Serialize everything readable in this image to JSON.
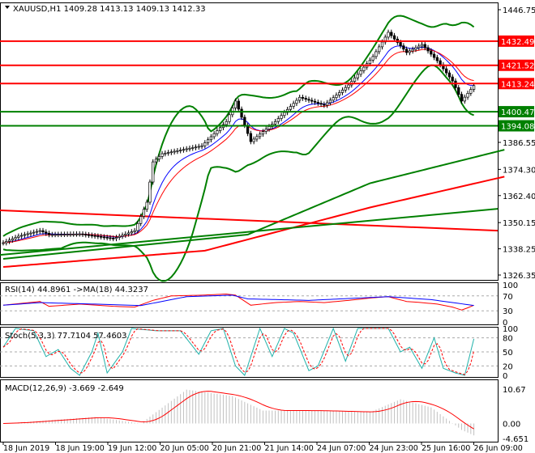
{
  "chart_data": {
    "type": "line",
    "title": "XAUUSD,H1",
    "ohlc": {
      "open": "1409.28",
      "high": "1413.13",
      "low": "1409.13",
      "close": "1412.33"
    },
    "price_axis": {
      "min": 1326.35,
      "max": 1446.75,
      "ticks": [
        "1446.75",
        "1386.55",
        "1374.30",
        "1362.40",
        "1350.15",
        "1338.25",
        "1326.35"
      ]
    },
    "levels": [
      {
        "value": 1432.49,
        "label": "1432.49",
        "color": "#ff0000"
      },
      {
        "value": 1421.52,
        "label": "1421.52",
        "color": "#ff0000"
      },
      {
        "value": 1413.24,
        "label": "1413.24",
        "color": "#ff0000"
      },
      {
        "value": 1400.47,
        "label": "1400.47",
        "color": "#008000"
      },
      {
        "value": 1394.08,
        "label": "1394.08",
        "color": "#008000"
      }
    ],
    "bars": 155,
    "close_anchors": [
      [
        0,
        1341
      ],
      [
        5,
        1344
      ],
      [
        12,
        1346.5
      ],
      [
        15,
        1344.7
      ],
      [
        25,
        1345
      ],
      [
        36,
        1342.9
      ],
      [
        43,
        1346.5
      ],
      [
        47,
        1359.4
      ],
      [
        49,
        1377.7
      ],
      [
        52,
        1381.4
      ],
      [
        65,
        1385
      ],
      [
        73,
        1396
      ],
      [
        76,
        1405.3
      ],
      [
        81,
        1386.9
      ],
      [
        89,
        1396
      ],
      [
        97,
        1407
      ],
      [
        105,
        1403.4
      ],
      [
        113,
        1412.6
      ],
      [
        121,
        1425.5
      ],
      [
        126,
        1436.5
      ],
      [
        132,
        1427.3
      ],
      [
        137,
        1431
      ],
      [
        142,
        1423.6
      ],
      [
        147,
        1414.4
      ],
      [
        150,
        1405.3
      ],
      [
        154,
        1412.33
      ]
    ],
    "ma_green_anchors": [
      [
        0,
        1333.7
      ],
      [
        80,
        1344.7
      ],
      [
        120,
        1368
      ],
      [
        164,
        1383.2
      ]
    ],
    "ma_red_anchors": [
      [
        0,
        1330
      ],
      [
        66,
        1337.4
      ],
      [
        120,
        1357
      ],
      [
        164,
        1371
      ]
    ],
    "trend_red": [
      [
        0,
        1355.7
      ],
      [
        170,
        1346.5
      ]
    ],
    "trend_green": [
      [
        0,
        1335.5
      ],
      [
        170,
        1356.4
      ]
    ],
    "time_labels": [
      "18 Jun 2019",
      "18 Jun 19:00",
      "19 Jun 12:00",
      "20 Jun 05:00",
      "20 Jun 21:00",
      "21 Jun 14:00",
      "24 Jun 07:00",
      "24 Jun 23:00",
      "25 Jun 16:00",
      "26 Jun 09:00"
    ],
    "rsi": {
      "label": "RSI(14) 44.8961  ->MA(18) 44.3237",
      "ticks": [
        "100",
        "70",
        "30",
        "0"
      ],
      "anchors": [
        [
          0,
          45
        ],
        [
          12,
          55
        ],
        [
          15,
          42
        ],
        [
          25,
          48
        ],
        [
          36,
          42
        ],
        [
          43,
          40
        ],
        [
          49,
          58
        ],
        [
          55,
          70
        ],
        [
          65,
          72
        ],
        [
          73,
          75
        ],
        [
          76,
          72
        ],
        [
          81,
          45
        ],
        [
          89,
          52
        ],
        [
          97,
          55
        ],
        [
          105,
          52
        ],
        [
          113,
          58
        ],
        [
          121,
          65
        ],
        [
          126,
          68
        ],
        [
          132,
          55
        ],
        [
          137,
          52
        ],
        [
          142,
          48
        ],
        [
          147,
          40
        ],
        [
          150,
          32
        ],
        [
          152,
          38
        ],
        [
          154,
          44.9
        ]
      ],
      "ma_anchors": [
        [
          0,
          45
        ],
        [
          12,
          52
        ],
        [
          30,
          48
        ],
        [
          45,
          44
        ],
        [
          60,
          68
        ],
        [
          75,
          72
        ],
        [
          80,
          62
        ],
        [
          100,
          58
        ],
        [
          126,
          68
        ],
        [
          140,
          60
        ],
        [
          154,
          44.3
        ]
      ]
    },
    "stoch": {
      "label": "Stoch(5,3,3) 77.7104 57.4603",
      "ticks": [
        "100",
        "80",
        "50",
        "20",
        "0"
      ],
      "anchors": [
        [
          0,
          60
        ],
        [
          4,
          100
        ],
        [
          10,
          95
        ],
        [
          14,
          40
        ],
        [
          18,
          55
        ],
        [
          22,
          15
        ],
        [
          25,
          0
        ],
        [
          29,
          50
        ],
        [
          31,
          90
        ],
        [
          34,
          5
        ],
        [
          39,
          50
        ],
        [
          42,
          100
        ],
        [
          50,
          95
        ],
        [
          58,
          95
        ],
        [
          64,
          45
        ],
        [
          68,
          95
        ],
        [
          72,
          100
        ],
        [
          76,
          20
        ],
        [
          79,
          0
        ],
        [
          84,
          100
        ],
        [
          88,
          40
        ],
        [
          92,
          100
        ],
        [
          95,
          90
        ],
        [
          100,
          10
        ],
        [
          103,
          20
        ],
        [
          108,
          100
        ],
        [
          112,
          30
        ],
        [
          116,
          100
        ],
        [
          126,
          100
        ],
        [
          130,
          50
        ],
        [
          133,
          60
        ],
        [
          137,
          15
        ],
        [
          141,
          80
        ],
        [
          144,
          15
        ],
        [
          148,
          5
        ],
        [
          151,
          0
        ],
        [
          154,
          77.7
        ]
      ]
    },
    "macd": {
      "label": "MACD(12,26,9) -3.669 -2.649",
      "ticks": [
        "10.67",
        "0.00",
        "-4.651"
      ],
      "min": -4.651,
      "max": 10.67,
      "anchors": [
        [
          0,
          0
        ],
        [
          30,
          2
        ],
        [
          45,
          0
        ],
        [
          60,
          10.5
        ],
        [
          75,
          8.5
        ],
        [
          85,
          4
        ],
        [
          100,
          4
        ],
        [
          120,
          3.5
        ],
        [
          130,
          7.5
        ],
        [
          140,
          5
        ],
        [
          150,
          -2
        ],
        [
          154,
          -3.7
        ]
      ]
    }
  }
}
